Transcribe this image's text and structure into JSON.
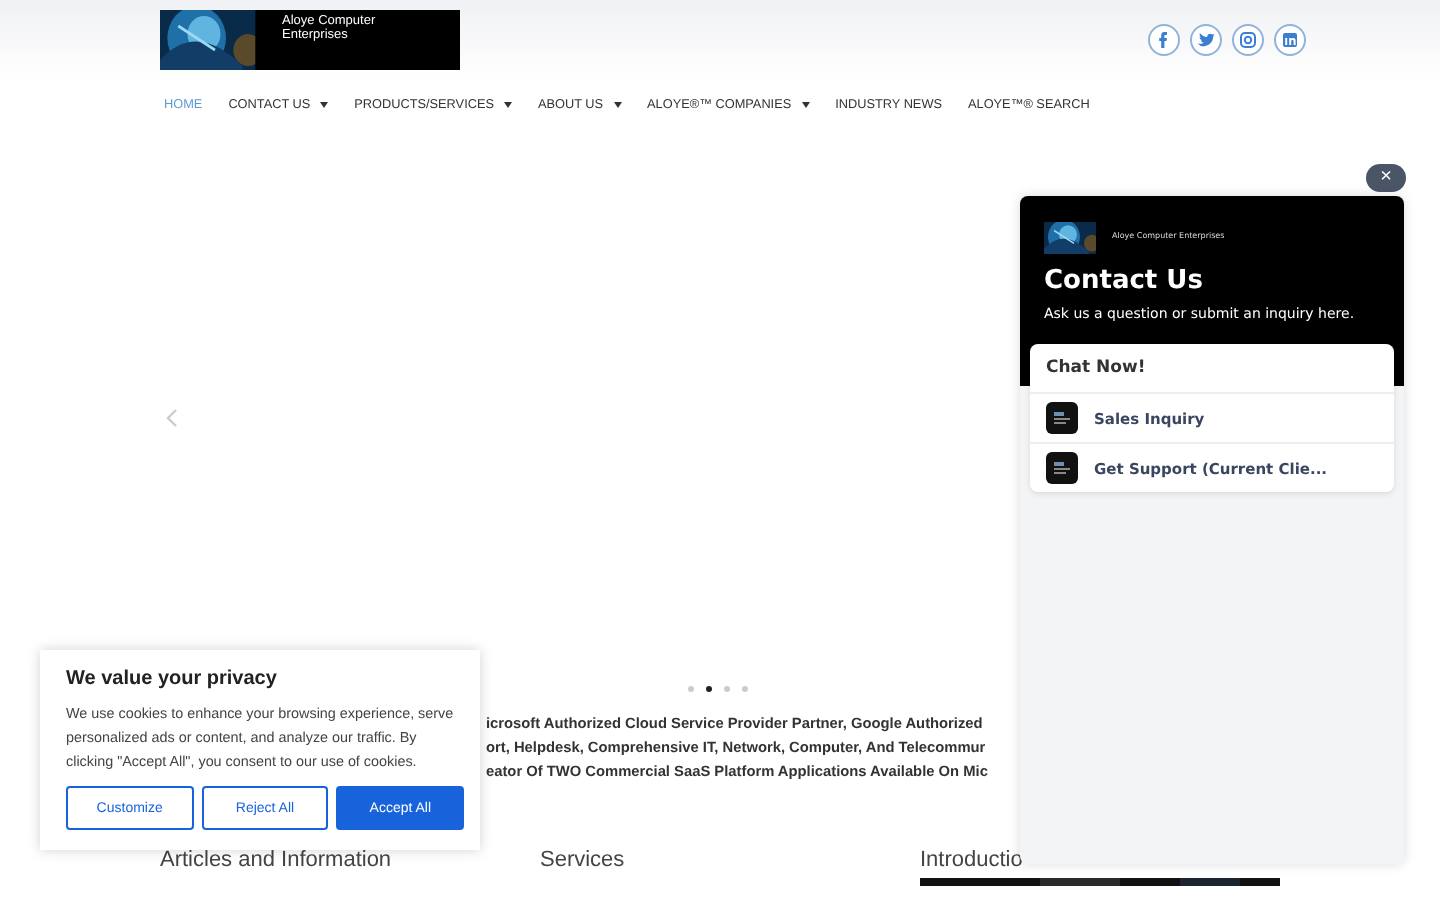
{
  "header": {
    "logo_text": "Aloye Computer Enterprises",
    "social": [
      {
        "kind": "facebook"
      },
      {
        "kind": "twitter"
      },
      {
        "kind": "instagram"
      },
      {
        "kind": "linkedin"
      }
    ]
  },
  "nav": [
    {
      "label": "HOME",
      "selected": true,
      "has_menu": false
    },
    {
      "label": "CONTACT US",
      "selected": false,
      "has_menu": true
    },
    {
      "label": "PRODUCTS/SERVICES",
      "selected": false,
      "has_menu": true
    },
    {
      "label": "ABOUT US",
      "selected": false,
      "has_menu": true
    },
    {
      "label": "ALOYE®™ COMPANIES",
      "selected": false,
      "has_menu": true
    },
    {
      "label": "INDUSTRY NEWS",
      "selected": false,
      "has_menu": false
    },
    {
      "label": "ALOYE™® SEARCH",
      "selected": false,
      "has_menu": false
    }
  ],
  "slider": {
    "dots": [
      {
        "selected": false
      },
      {
        "selected": true
      },
      {
        "selected": false
      },
      {
        "selected": false
      }
    ]
  },
  "intro_lines": [
    "icrosoft Authorized Cloud Service Provider Partner, Google Authorized",
    "ort, Helpdesk, Comprehensive IT, Network, Computer, And Telecommur",
    "eator Of TWO Commercial SaaS Platform Applications Available On Mic"
  ],
  "sections": [
    "Articles and Information",
    "Services",
    "Introductio"
  ],
  "cookie_banner": {
    "title": "We value your privacy",
    "text": "We use cookies to enhance your browsing experience, serve personalized ads or content, and analyze our traffic. By clicking \"Accept All\", you consent to our use of cookies.",
    "buttons": [
      {
        "label": "Customize",
        "kind": "outline"
      },
      {
        "label": "Reject All",
        "kind": "outline"
      },
      {
        "label": "Accept All",
        "kind": "primary"
      }
    ]
  },
  "chat_widget": {
    "close": "×",
    "logo_text": "Aloye Computer Enterprises",
    "title": "Contact Us",
    "subtitle": "Ask us a question or submit an inquiry here.",
    "card_title": "Chat Now!",
    "options": [
      "Sales Inquiry",
      "Get Support (Current Clie..."
    ]
  }
}
